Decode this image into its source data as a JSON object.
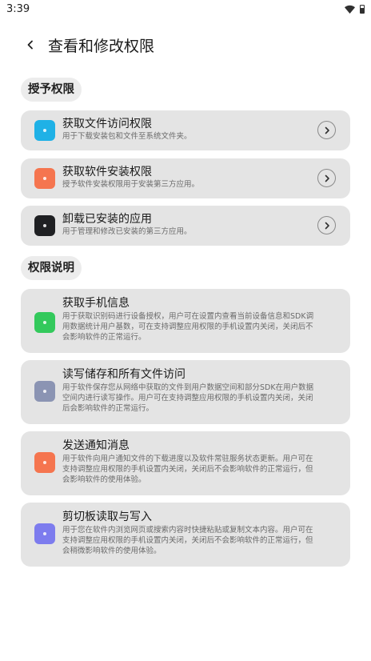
{
  "status": {
    "time": "3:39"
  },
  "header": {
    "title": "查看和修改权限"
  },
  "grant_section": {
    "label": "授予权限",
    "items": [
      {
        "title": "获取文件访问权限",
        "desc": "用于下载安装包和文件至系统文件夹。",
        "icon": "folder-icon",
        "color": "#1fb1e6"
      },
      {
        "title": "获取软件安装权限",
        "desc": "授予软件安装权限用于安装第三方应用。",
        "icon": "install-icon",
        "color": "#f5754f"
      },
      {
        "title": "卸载已安装的应用",
        "desc": "用于管理和修改已安装的第三方应用。",
        "icon": "uninstall-icon",
        "color": "#1f2023"
      }
    ]
  },
  "explain_section": {
    "label": "权限说明",
    "items": [
      {
        "title": "获取手机信息",
        "desc": [
          "用于获取识别码进行设备授权，用户可在设置内查看当前设备信息和SDK调",
          "用数据统计用户基数，可在支持调整应用权限的手机设置内关闭，关闭后不",
          "会影响软件的正常运行。"
        ],
        "icon": "phone-icon",
        "color": "#33c95c"
      },
      {
        "title": "读写储存和所有文件访问",
        "desc": [
          "用于软件保存您从网络中获取的文件到用户数据空间和部分SDK在用户数据",
          "空间内进行读写操作。用户可在支持调整应用权限的手机设置内关闭，关闭",
          "后会影响软件的正常运行。"
        ],
        "icon": "storage-icon",
        "color": "#8b94b3"
      },
      {
        "title": "发送通知消息",
        "desc": [
          "用于软件向用户通知文件的下载进度以及软件常驻服务状态更新。用户可在",
          "支持调整应用权限的手机设置内关闭，关闭后不会影响软件的正常运行，但",
          "会影响软件的使用体验。"
        ],
        "icon": "notification-icon",
        "color": "#f5754f"
      },
      {
        "title": "剪切板读取与写入",
        "desc": [
          "用于您在软件内浏览网页或搜索内容时快捷粘贴或复制文本内容。用户可在",
          "支持调整应用权限的手机设置内关闭，关闭后不会影响软件的正常运行，但",
          "会稍微影响软件的使用体验。"
        ],
        "icon": "clipboard-icon",
        "color": "#7d7cee"
      }
    ]
  }
}
